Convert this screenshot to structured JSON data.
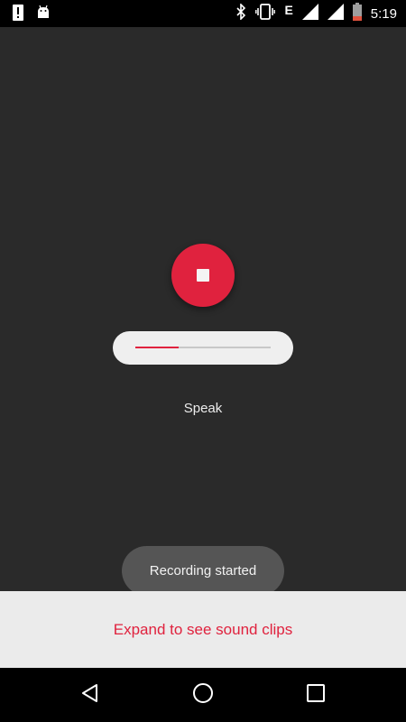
{
  "status_bar": {
    "time": "5:19",
    "network_type": "E",
    "icons": [
      "alert-icon",
      "android-icon",
      "bluetooth-icon",
      "vibrate-icon",
      "signal-icon",
      "signal-icon",
      "battery-icon"
    ]
  },
  "recorder": {
    "record_button_icon": "stop-icon",
    "level_fraction": 0.32,
    "speak_label": "Speak"
  },
  "toast": {
    "message": "Recording started"
  },
  "bottom_sheet": {
    "expand_label": "Expand to see sound clips"
  },
  "nav_bar": {
    "icons": [
      "back-icon",
      "home-icon",
      "recents-icon"
    ]
  },
  "colors": {
    "accent": "#e0223e",
    "background": "#2a2a2a",
    "sheet": "#ebebeb"
  }
}
